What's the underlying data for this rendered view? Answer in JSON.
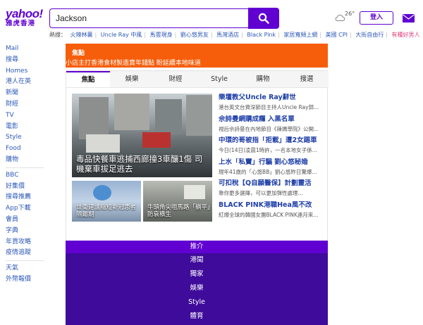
{
  "brand": {
    "logo_main": "yahoo!",
    "logo_sub": "雅虎香港"
  },
  "search": {
    "value": "Jackson",
    "button_icon": "search-icon"
  },
  "header": {
    "temperature": "26°",
    "login_label": "登入",
    "mail_icon": "mail-icon"
  },
  "trending": {
    "label": "熱搜：",
    "items": [
      "火辣林襄",
      "Uncle Ray 中風",
      "馬雲現身",
      "劉心悠男友",
      "馬灣酒店",
      "Black Pink",
      "家居寬頻上網",
      "美國 CPI",
      "大街自由行",
      "有種好男人"
    ]
  },
  "sidebar": {
    "group1": [
      "Mail",
      "搜尋",
      "Homes",
      "港人在英",
      "新聞",
      "財經",
      "TV",
      "電影",
      "Style",
      "Food",
      "購物"
    ],
    "group2": [
      "BBC",
      "好集價",
      "搜尋推薦",
      "App下載",
      "會員",
      "字典",
      "年貨攻略",
      "疫情追蹤"
    ],
    "group3": [
      "天氣",
      "外幣報價"
    ]
  },
  "banner": {
    "label": "焦點",
    "text": "小店主打香港食材製造寶年錢點 盼延續本地味道"
  },
  "tabs": [
    "焦點",
    "娛樂",
    "財經",
    "Style",
    "購物",
    "搜選"
  ],
  "hero": {
    "caption": "毒品快餐車逃捕西廊撞3車釀1傷 司機棄車拔足逃去"
  },
  "thumbs": [
    {
      "caption": "世衛建議縮短新冠患者隔離期"
    },
    {
      "caption": "牛頭角尖咀馬路「躺平」防衰橫生"
    }
  ],
  "stories": [
    {
      "title": "樂壇教父Uncle Ray辭世",
      "sub": "港台英文台資深節目主持人Uncle Ray郭..."
    },
    {
      "title": "佘詩曼網購成癮 入黑名單",
      "sub": "視后佘詩曼在內地節目《辣媽學院》公開..."
    },
    {
      "title": "中環的哥被指「拒載」遭2女踢車",
      "sub": "今日(14日)凌晨1時許，一名本地女子係..."
    },
    {
      "title": "上水「私竇」行騙 劉心悠秘婚",
      "sub": "現年41歲的「心悠BB」劉心悠昨日驚爆..."
    },
    {
      "title": "可扣稅【Q自願醫保】計劃靈活",
      "sub": "靠你更多選擇，可以更加彈性處理..."
    },
    {
      "title": "BLACK PINK港職Hea風不改",
      "sub": "紅爆全球的韓國女團BLACK PINK連月來..."
    }
  ],
  "menu": {
    "header": "推介",
    "items": [
      "港聞",
      "獨家",
      "娛樂",
      "Style",
      "體育"
    ]
  },
  "colors": {
    "brand_purple": "#6001d2",
    "banner_orange": "#f65e0b",
    "link_blue": "#2c58b7",
    "menu_bg": "#3e0b9b"
  }
}
